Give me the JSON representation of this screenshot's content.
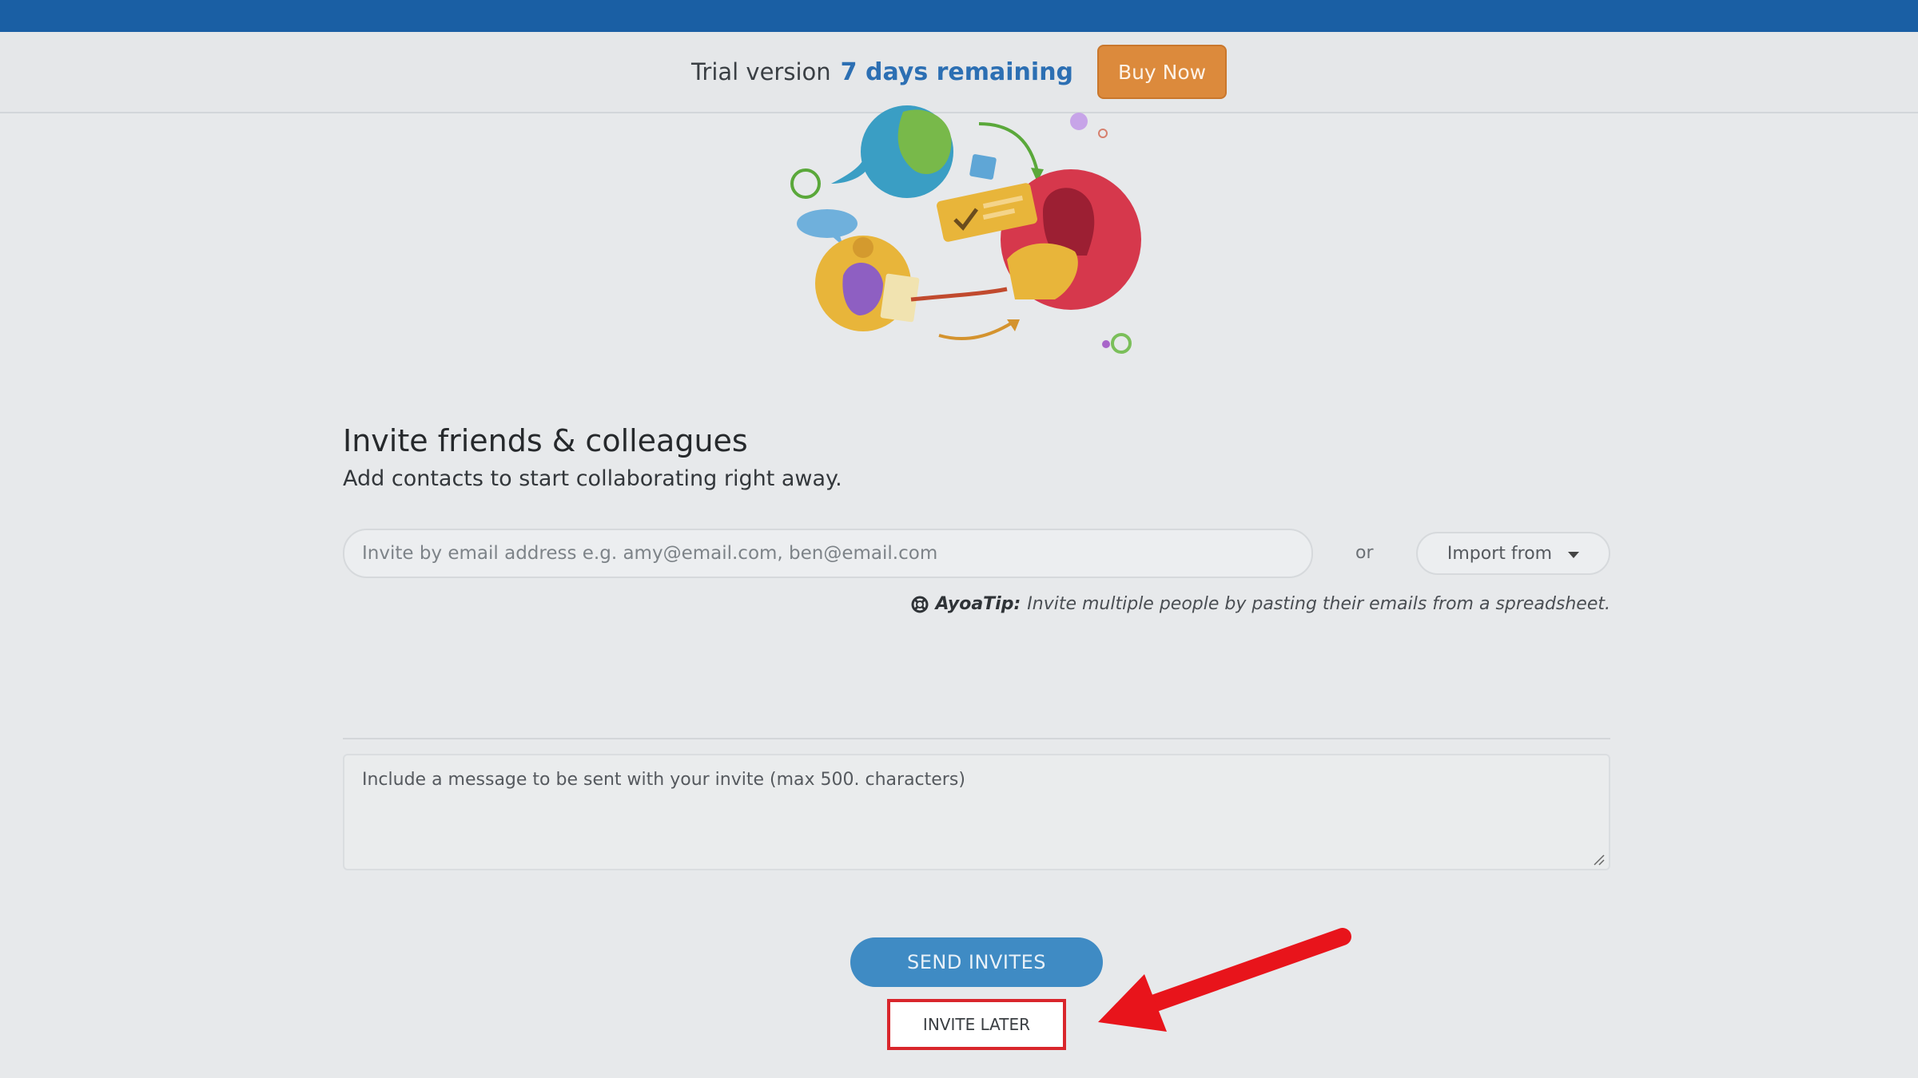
{
  "trial_bar": {
    "label": "Trial version",
    "days_remaining": "7 days remaining",
    "buy_button": "Buy Now"
  },
  "invite": {
    "title": "Invite friends & colleagues",
    "subtitle": "Add contacts to start collaborating right away.",
    "email_placeholder": "Invite by email address e.g. amy@email.com, ben@email.com",
    "or_text": "or",
    "import_label": "Import from",
    "tip_label": "AyoaTip:",
    "tip_text": "Invite multiple people by pasting their emails from a spreadsheet.",
    "message_placeholder": "Include a message to be sent with your invite (max 500. characters)",
    "send_button": "SEND INVITES",
    "later_button": "INVITE LATER"
  },
  "colors": {
    "top_bar": "#1a5fa4",
    "buy_button": "#dc8a3c",
    "days_remaining": "#2c6fb3",
    "send_button": "#3f8bc4",
    "highlight": "#d9262c"
  }
}
